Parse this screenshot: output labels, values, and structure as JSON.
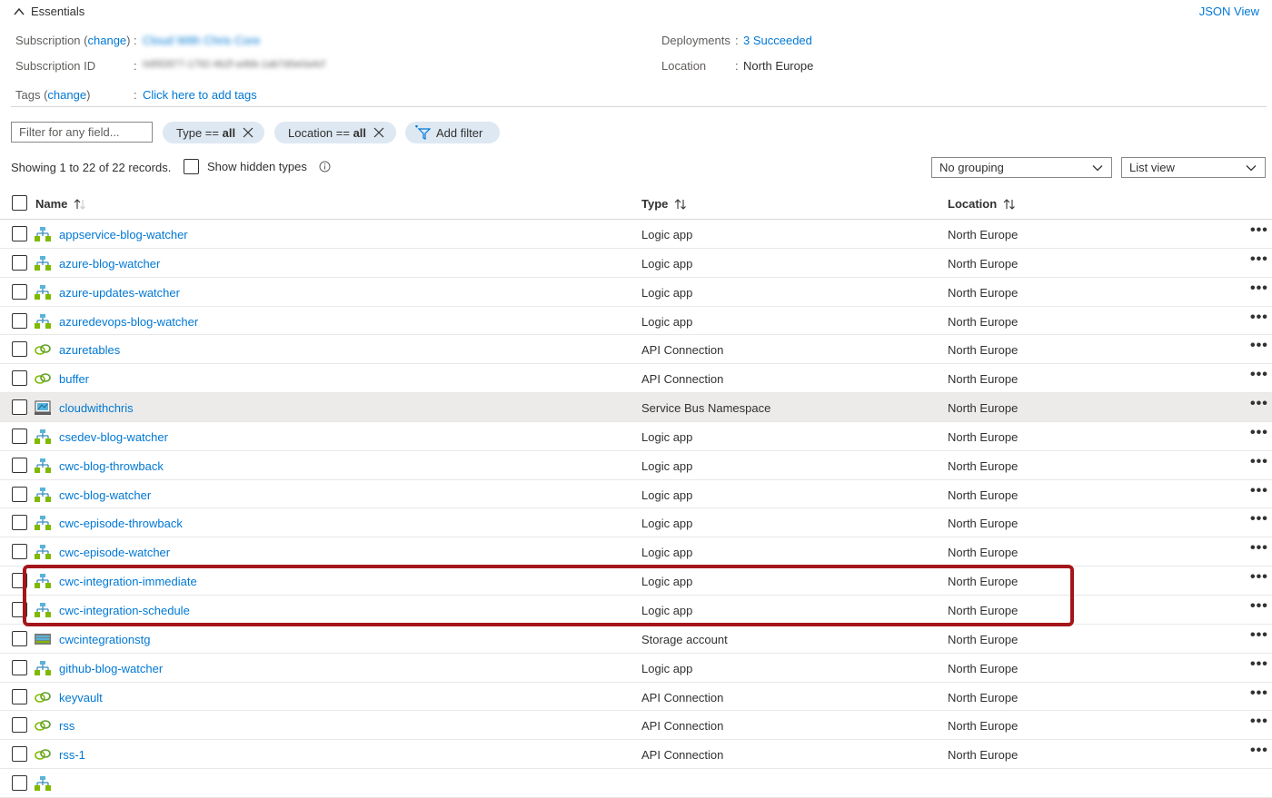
{
  "essentials": {
    "toggle_label": "Essentials",
    "json_view": "JSON View",
    "subscription_label": "Subscription",
    "subscription_change": "change",
    "subscription_value": "Cloud With Chris Core",
    "subscription_id_label": "Subscription ID",
    "subscription_id_value": "0d5f2877-1792-4b2f-a4bb-1ab7d0e0a4cf",
    "tags_label": "Tags",
    "tags_change": "change",
    "tags_value": "Click here to add tags",
    "deployments_label": "Deployments",
    "deployments_value": "3 Succeeded",
    "location_label": "Location",
    "location_value": "North Europe"
  },
  "filters": {
    "input_placeholder": "Filter for any field...",
    "type_pill_prefix": "Type ==",
    "type_pill_value": "all",
    "location_pill_prefix": "Location ==",
    "location_pill_value": "all",
    "add_filter_label": "Add filter"
  },
  "records_text": "Showing 1 to 22 of 22 records.",
  "show_hidden_label": "Show hidden types",
  "grouping_select": "No grouping",
  "view_select": "List view",
  "table": {
    "col_name": "Name",
    "col_type": "Type",
    "col_location": "Location",
    "rows": [
      {
        "name": "appservice-blog-watcher",
        "type": "Logic app",
        "location": "North Europe",
        "icon": "logic-app-icon"
      },
      {
        "name": "azure-blog-watcher",
        "type": "Logic app",
        "location": "North Europe",
        "icon": "logic-app-icon"
      },
      {
        "name": "azure-updates-watcher",
        "type": "Logic app",
        "location": "North Europe",
        "icon": "logic-app-icon"
      },
      {
        "name": "azuredevops-blog-watcher",
        "type": "Logic app",
        "location": "North Europe",
        "icon": "logic-app-icon"
      },
      {
        "name": "azuretables",
        "type": "API Connection",
        "location": "North Europe",
        "icon": "api-connection-icon"
      },
      {
        "name": "buffer",
        "type": "API Connection",
        "location": "North Europe",
        "icon": "api-connection-icon"
      },
      {
        "name": "cloudwithchris",
        "type": "Service Bus Namespace",
        "location": "North Europe",
        "icon": "service-bus-icon"
      },
      {
        "name": "csedev-blog-watcher",
        "type": "Logic app",
        "location": "North Europe",
        "icon": "logic-app-icon"
      },
      {
        "name": "cwc-blog-throwback",
        "type": "Logic app",
        "location": "North Europe",
        "icon": "logic-app-icon"
      },
      {
        "name": "cwc-blog-watcher",
        "type": "Logic app",
        "location": "North Europe",
        "icon": "logic-app-icon"
      },
      {
        "name": "cwc-episode-throwback",
        "type": "Logic app",
        "location": "North Europe",
        "icon": "logic-app-icon"
      },
      {
        "name": "cwc-episode-watcher",
        "type": "Logic app",
        "location": "North Europe",
        "icon": "logic-app-icon"
      },
      {
        "name": "cwc-integration-immediate",
        "type": "Logic app",
        "location": "North Europe",
        "icon": "logic-app-icon"
      },
      {
        "name": "cwc-integration-schedule",
        "type": "Logic app",
        "location": "North Europe",
        "icon": "logic-app-icon"
      },
      {
        "name": "cwcintegrationstg",
        "type": "Storage account",
        "location": "North Europe",
        "icon": "storage-account-icon"
      },
      {
        "name": "github-blog-watcher",
        "type": "Logic app",
        "location": "North Europe",
        "icon": "logic-app-icon"
      },
      {
        "name": "keyvault",
        "type": "API Connection",
        "location": "North Europe",
        "icon": "api-connection-icon"
      },
      {
        "name": "rss",
        "type": "API Connection",
        "location": "North Europe",
        "icon": "api-connection-icon"
      },
      {
        "name": "rss-1",
        "type": "API Connection",
        "location": "North Europe",
        "icon": "api-connection-icon"
      },
      {
        "name": "",
        "type": "",
        "location": "",
        "icon": "logic-app-icon"
      }
    ],
    "more_label": "•••"
  },
  "colors": {
    "link": "#0078d4",
    "pill_bg": "#dde8f3",
    "highlight_border": "#a4161a",
    "row_hover": "#edebe9"
  }
}
